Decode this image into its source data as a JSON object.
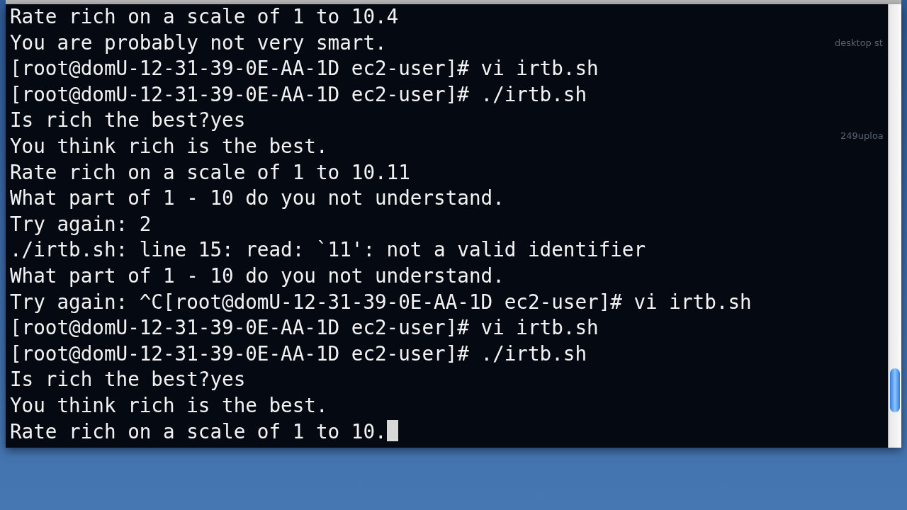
{
  "desktop_items": [
    {
      "label": "desktop st"
    },
    {
      "label": "249uploa"
    }
  ],
  "terminal": {
    "lines": [
      "Rate rich on a scale of 1 to 10.4",
      "You are probably not very smart.",
      "[root@domU-12-31-39-0E-AA-1D ec2-user]# vi irtb.sh",
      "[root@domU-12-31-39-0E-AA-1D ec2-user]# ./irtb.sh",
      "Is rich the best?yes",
      "You think rich is the best.",
      "Rate rich on a scale of 1 to 10.11",
      "What part of 1 - 10 do you not understand.",
      "Try again: 2",
      "./irtb.sh: line 15: read: `11': not a valid identifier",
      "What part of 1 - 10 do you not understand.",
      "Try again: ^C[root@domU-12-31-39-0E-AA-1D ec2-user]# vi irtb.sh",
      "[root@domU-12-31-39-0E-AA-1D ec2-user]# vi irtb.sh",
      "[root@domU-12-31-39-0E-AA-1D ec2-user]# ./irtb.sh",
      "Is rich the best?yes",
      "You think rich is the best.",
      "Rate rich on a scale of 1 to 10."
    ],
    "cursor_visible": true
  }
}
